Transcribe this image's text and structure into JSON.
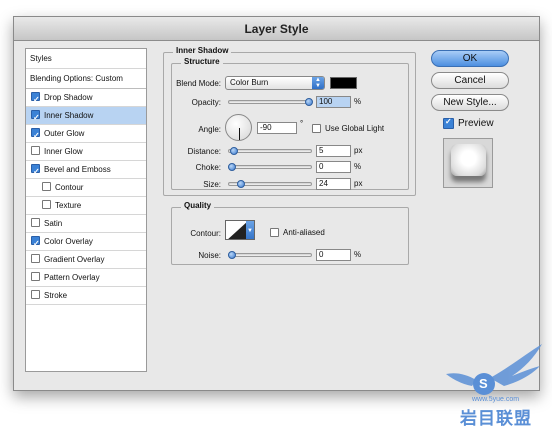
{
  "window": {
    "title": "Layer Style"
  },
  "styles_panel": {
    "header": "Styles",
    "blending": "Blending Options: Custom",
    "items": [
      {
        "label": "Drop Shadow",
        "checked": true,
        "indent": false,
        "selected": false
      },
      {
        "label": "Inner Shadow",
        "checked": true,
        "indent": false,
        "selected": true
      },
      {
        "label": "Outer Glow",
        "checked": true,
        "indent": false,
        "selected": false
      },
      {
        "label": "Inner Glow",
        "checked": false,
        "indent": false,
        "selected": false
      },
      {
        "label": "Bevel and Emboss",
        "checked": true,
        "indent": false,
        "selected": false
      },
      {
        "label": "Contour",
        "checked": false,
        "indent": true,
        "selected": false
      },
      {
        "label": "Texture",
        "checked": false,
        "indent": true,
        "selected": false
      },
      {
        "label": "Satin",
        "checked": false,
        "indent": false,
        "selected": false
      },
      {
        "label": "Color Overlay",
        "checked": true,
        "indent": false,
        "selected": false
      },
      {
        "label": "Gradient Overlay",
        "checked": false,
        "indent": false,
        "selected": false
      },
      {
        "label": "Pattern Overlay",
        "checked": false,
        "indent": false,
        "selected": false
      },
      {
        "label": "Stroke",
        "checked": false,
        "indent": false,
        "selected": false
      }
    ]
  },
  "inner_shadow": {
    "title": "Inner Shadow",
    "structure": {
      "title": "Structure",
      "blend_mode_label": "Blend Mode:",
      "blend_mode_value": "Color Burn",
      "blend_color": "#000000",
      "opacity_label": "Opacity:",
      "opacity_value": "100",
      "opacity_unit": "%",
      "angle_label": "Angle:",
      "angle_value": "-90",
      "angle_unit": "°",
      "global_light_label": "Use Global Light",
      "global_light_checked": false,
      "distance_label": "Distance:",
      "distance_value": "5",
      "distance_unit": "px",
      "choke_label": "Choke:",
      "choke_value": "0",
      "choke_unit": "%",
      "size_label": "Size:",
      "size_value": "24",
      "size_unit": "px"
    },
    "quality": {
      "title": "Quality",
      "contour_label": "Contour:",
      "anti_aliased_label": "Anti-aliased",
      "anti_aliased_checked": false,
      "noise_label": "Noise:",
      "noise_value": "0",
      "noise_unit": "%"
    }
  },
  "buttons": {
    "ok": "OK",
    "cancel": "Cancel",
    "new_style": "New Style...",
    "preview_label": "Preview",
    "preview_checked": true
  },
  "watermark": {
    "brand": "岩目联盟",
    "url": "www.5yue.com",
    "logo_letter": "S"
  }
}
